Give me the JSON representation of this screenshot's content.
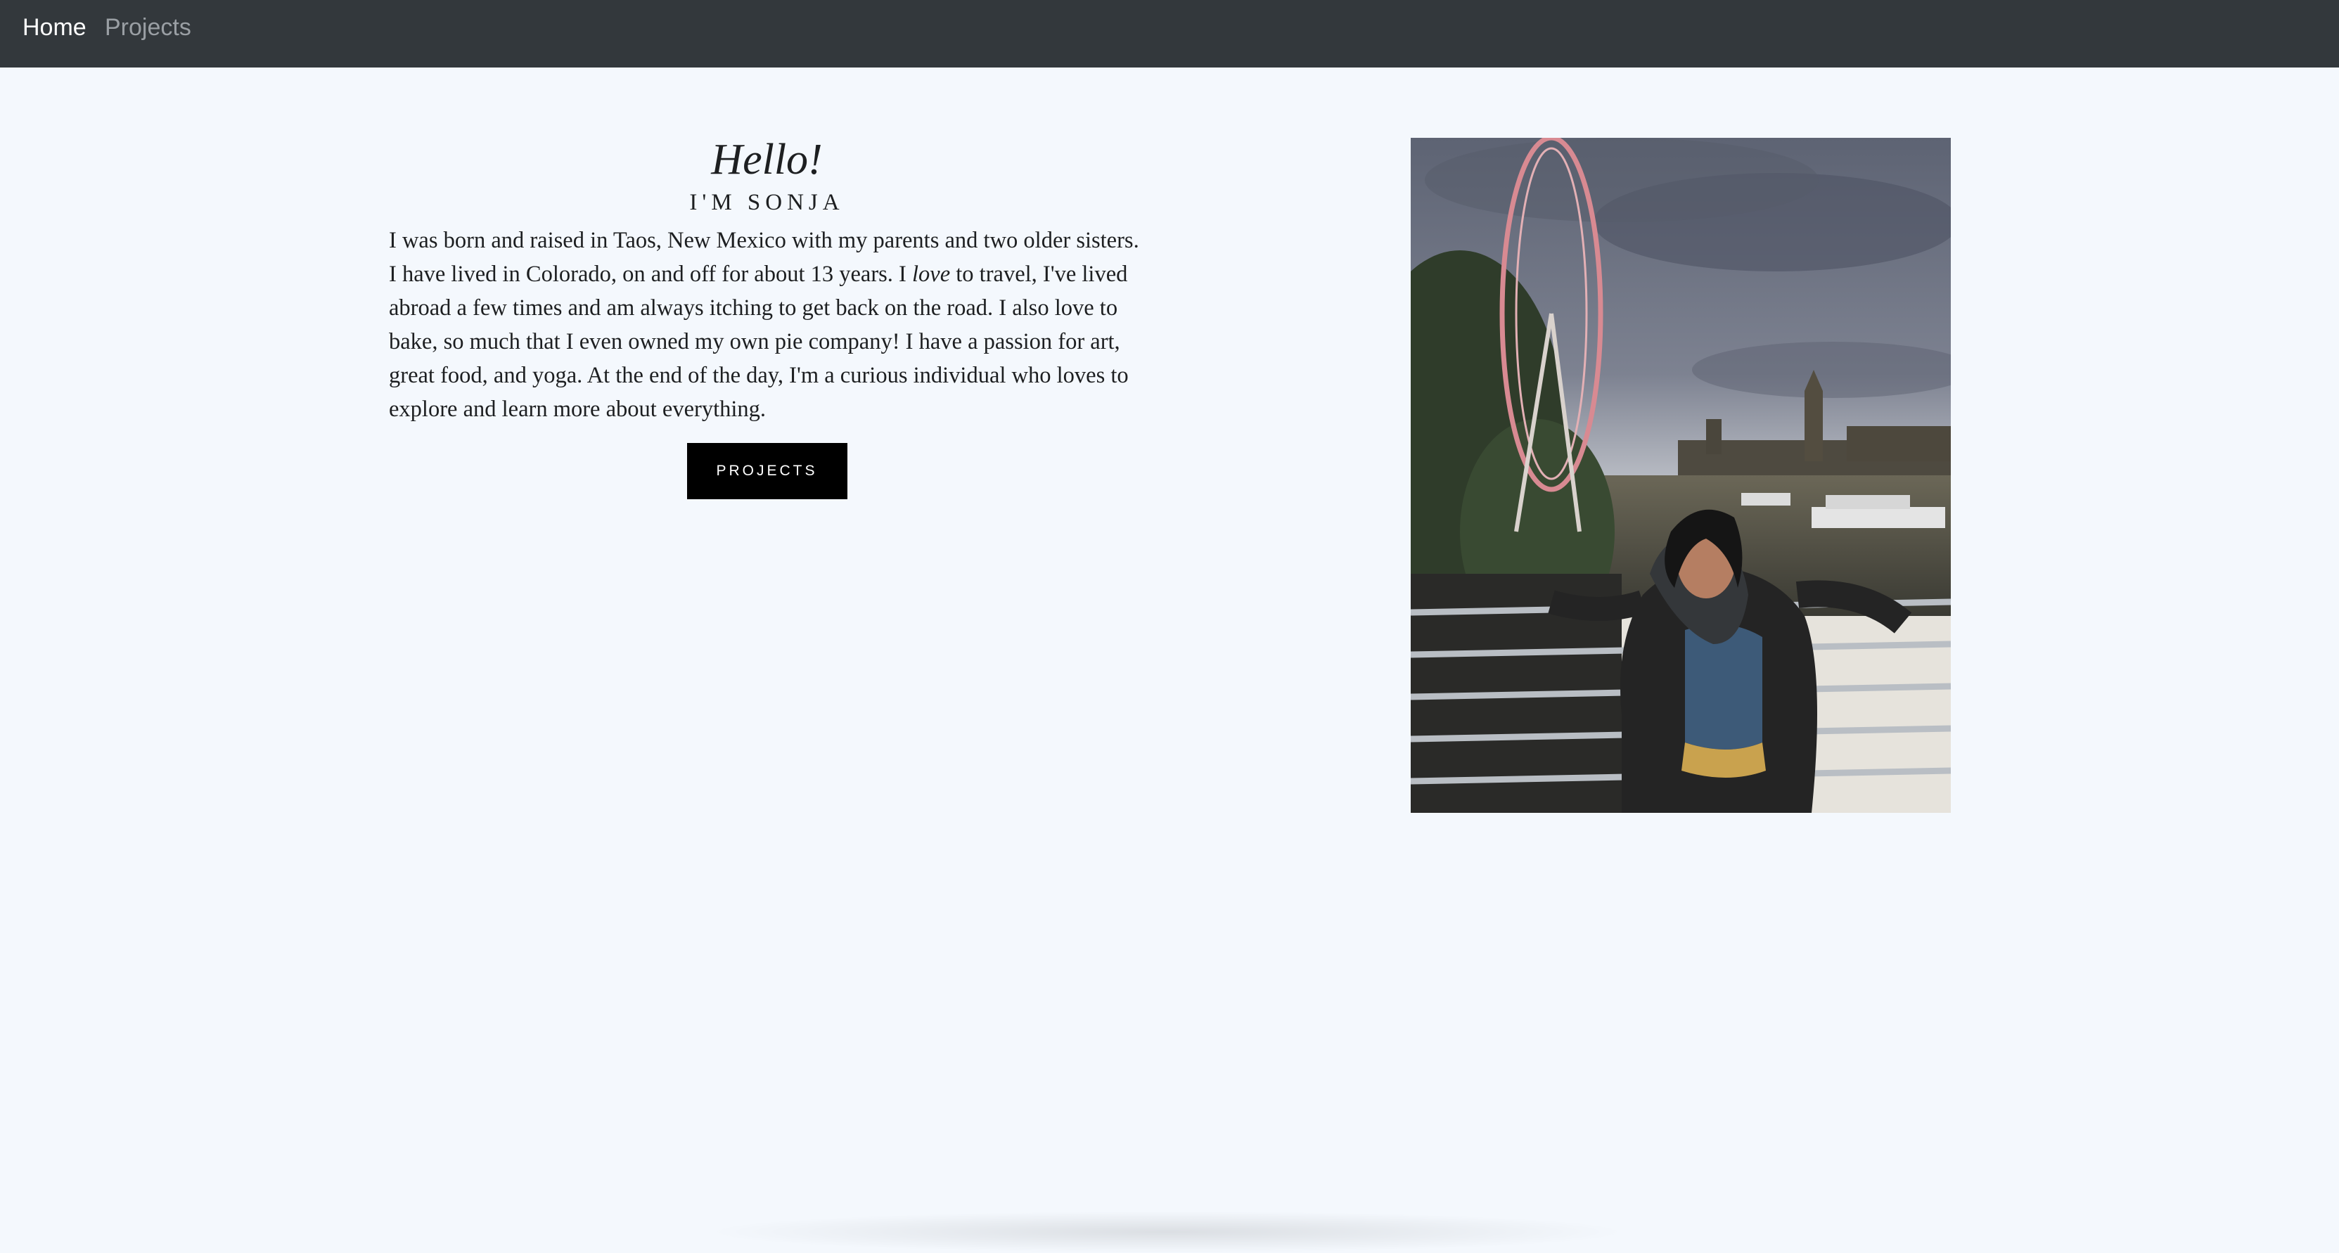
{
  "nav": {
    "home_label": "Home",
    "projects_label": "Projects"
  },
  "intro": {
    "heading": "Hello!",
    "subheading": "I'M SONJA",
    "bio_part1": "I was born and raised in Taos, New Mexico with my parents and two older sisters. I have lived in Colorado, on and off for about 13 years. I ",
    "bio_emphasis": "love",
    "bio_part2": " to travel, I've lived abroad a few times and am always itching to get back on the road. I also love to bake, so much that I even owned my own pie company! I have a passion for art, great food, and yoga. At the end of the day, I'm a curious individual who loves to explore and learn more about everything.",
    "button_label": "PROJECTS"
  },
  "colors": {
    "page_background": "#f4f8fd",
    "navbar": "#33383c",
    "nav_active": "#ffffff",
    "nav_inactive": "#9a9fa4",
    "button": "#000000"
  }
}
